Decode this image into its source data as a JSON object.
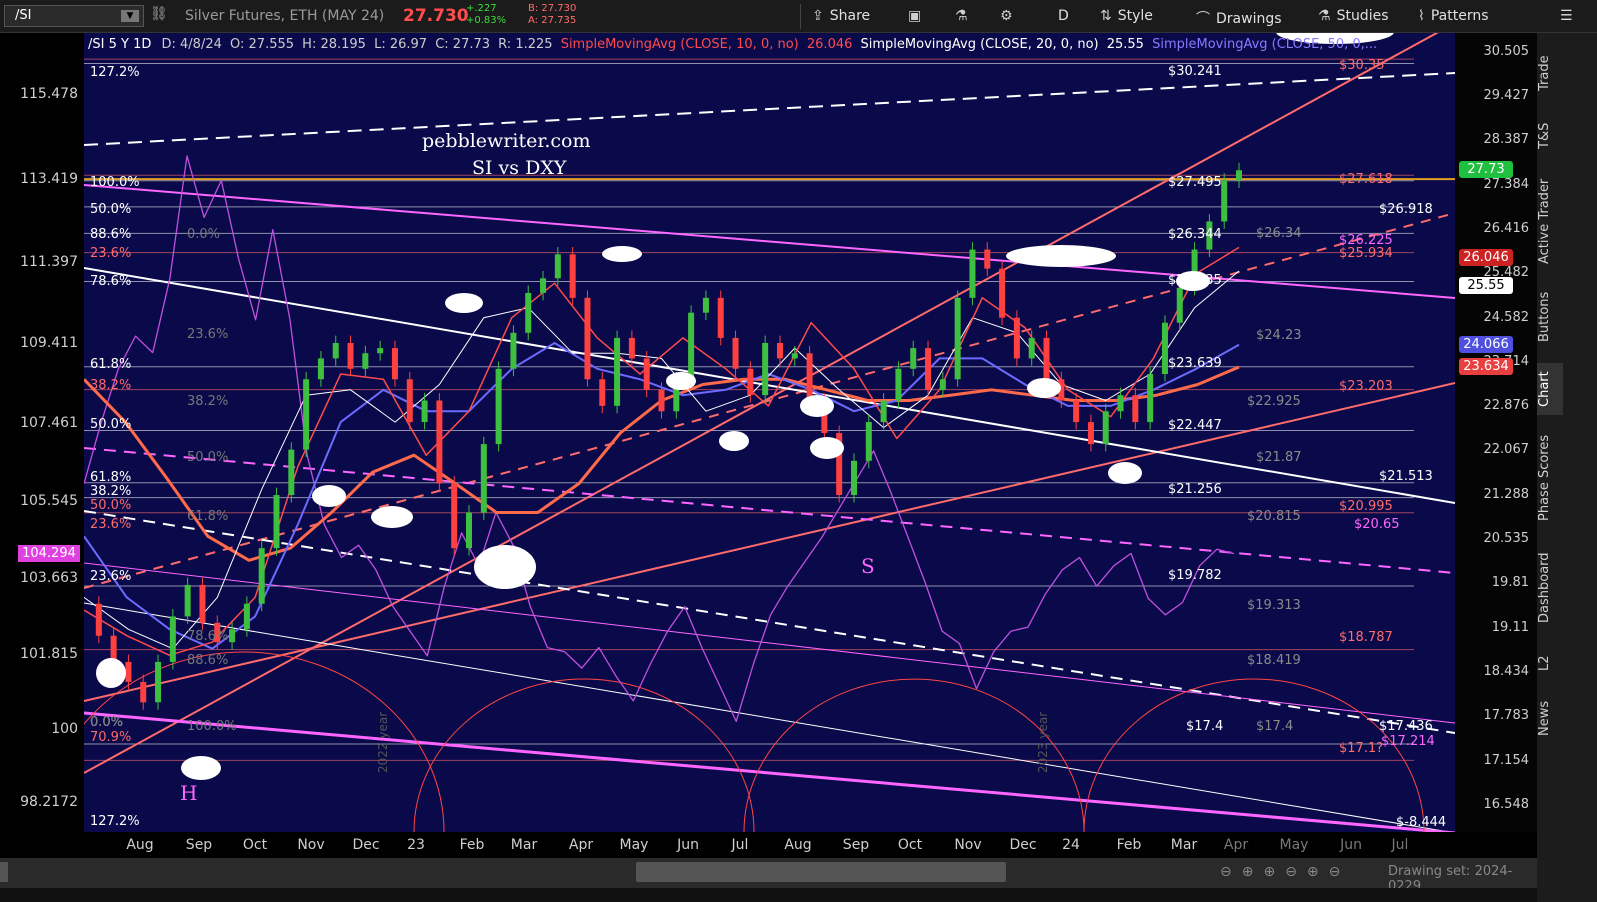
{
  "toolbar": {
    "symbol": "/SI",
    "instrument": "Silver Futures, ETH (MAY 24)",
    "last": "27.730",
    "change_abs": "+.227",
    "change_pct": "+0.83%",
    "bid": "B: 27.730",
    "ask": "A: 27.735",
    "share": "Share",
    "period": "D",
    "style": "Style",
    "drawings": "Drawings",
    "studies": "Studies",
    "patterns": "Patterns"
  },
  "studies_header": {
    "symbol_info": "/SI 5 Y 1D",
    "date": "D: 4/8/24",
    "open": "O: 27.555",
    "high": "H: 28.195",
    "low": "L: 26.97",
    "close": "C: 27.73",
    "range": "R: 1.225",
    "sma10": "SimpleMovingAvg (CLOSE, 10, 0, no)",
    "sma10_val": "26.046",
    "sma20": "SimpleMovingAvg (CLOSE, 20, 0, no)",
    "sma20_val": "25.55",
    "sma50": "SimpleMovingAvg (CLOSE, 50, 0,..."
  },
  "annotations": {
    "site": "pebblewriter.com",
    "subtitle": "SI vs DXY",
    "h_label": "H",
    "s_label": "S",
    "year_2022": "2022 year",
    "year_2023": "2023 year",
    "drawing_set": "Drawing set: 2024-0229"
  },
  "sidebar": [
    "Trade",
    "T&S",
    "Active Trader",
    "Buttons",
    "Chart",
    "Phase Scores",
    "Dashboard",
    "L2",
    "News"
  ],
  "colors": {
    "plot_bg": "#0a0a4a",
    "price_up": "#3fbf3f",
    "price_down": "#ff4040",
    "sma10": "#ff4b4b",
    "sma20": "#ffffff",
    "sma50": "#6b6bff",
    "sma_yellow": "#e8c21a",
    "sma_orange": "#ff6a4a",
    "dxy": "#c050e0",
    "fib_orange": "#ff6b6b",
    "fib_white": "#ffffff",
    "magenta": "#ff66ff"
  },
  "chart_data": {
    "type": "line",
    "title": "pebblewriter.com SI vs DXY",
    "right_axis": {
      "label": "Silver /SI",
      "ticks": [
        "30.505",
        "29.427",
        "28.387",
        "27.384",
        "26.416",
        "25.482",
        "24.582",
        "23.714",
        "22.876",
        "22.067",
        "21.288",
        "20.535",
        "19.81",
        "19.11",
        "18.434",
        "17.783",
        "17.154",
        "16.548"
      ],
      "ylim": [
        16.2,
        31.0
      ]
    },
    "left_axis": {
      "label": "DXY",
      "ticks": [
        "115.478",
        "113.419",
        "111.397",
        "109.411",
        "107.461",
        "105.545",
        "103.663",
        "101.815",
        "100",
        "98.2172"
      ],
      "highlight": "104.294",
      "ylim": [
        97.5,
        117.0
      ]
    },
    "x_axis": {
      "ticks": [
        "Aug",
        "Sep",
        "Oct",
        "Nov",
        "Dec",
        "23",
        "Feb",
        "Mar",
        "Apr",
        "May",
        "Jun",
        "Jul",
        "Aug",
        "Sep",
        "Oct",
        "Nov",
        "Dec",
        "24",
        "Feb",
        "Mar",
        "Apr",
        "May",
        "Jun",
        "Jul"
      ]
    },
    "price_tags": [
      {
        "value": "27.73",
        "color": "#1fbf3f"
      },
      {
        "value": "26.046",
        "color": "#cc2222"
      },
      {
        "value": "25.55",
        "color": "#ffffff"
      },
      {
        "value": "24.066",
        "color": "#5050e0"
      },
      {
        "value": "23.634",
        "color": "#e84040"
      }
    ],
    "level_labels_white": [
      "$30.241",
      "$27.495",
      "$26.918",
      "$26.344",
      "$25.335",
      "$23.639",
      "$22.447",
      "$21.513",
      "$21.256",
      "$19.782",
      "$17.4",
      "$17.436",
      "$-8.444"
    ],
    "level_labels_orange": [
      "$30.35",
      "$27.618",
      "$25.934",
      "$23.203",
      "$20.995",
      "$18.787",
      "$17.1?"
    ],
    "level_labels_magenta": [
      "$26.225",
      "$20.65",
      "$17.214"
    ],
    "level_labels_gray": [
      "$26.34",
      "$24.23",
      "$22.925",
      "$21.87",
      "$20.815",
      "$19.313",
      "$18.419",
      "$17.4"
    ],
    "fib_labels_left": [
      "127.2%",
      "100.0%",
      "50.0%",
      "88.6%",
      "23.6%",
      "78.6%",
      "61.8%",
      "38.2%",
      "50.0%",
      "61.8%",
      "38.2%",
      "50.0%",
      "23.6%",
      "23.6%",
      "0.0%",
      "70.9%",
      "127.2%"
    ],
    "fib_labels_gray": [
      "0.0%",
      "23.6%",
      "38.2%",
      "50.0%",
      "61.8%",
      "78.6%",
      "88.6%",
      "100.0%",
      "0.0%"
    ],
    "series": [
      {
        "name": "/SI",
        "values": [
          19.5,
          19.0,
          18.6,
          18.3,
          18.0,
          18.6,
          19.3,
          19.8,
          19.2,
          18.9,
          19.1,
          19.5,
          20.4,
          21.3,
          22.1,
          23.4,
          23.8,
          24.1,
          23.6,
          23.9,
          24.0,
          23.4,
          22.6,
          23.0,
          21.5,
          20.4,
          21.0,
          22.2,
          23.6,
          24.3,
          25.1,
          25.4,
          25.9,
          25.0,
          23.4,
          22.9,
          24.2,
          23.8,
          23.2,
          22.8,
          23.4,
          24.7,
          25.0,
          24.2,
          23.6,
          23.1,
          24.1,
          23.8,
          23.9,
          23.0,
          22.4,
          21.3,
          21.9,
          22.6,
          23.0,
          23.6,
          24.0,
          23.2,
          23.4,
          25.0,
          26.0,
          25.6,
          24.6,
          23.8,
          24.2,
          23.4,
          23.0,
          22.6,
          22.2,
          22.8,
          23.1,
          22.6,
          23.5,
          24.5,
          25.2,
          26.0,
          26.6,
          27.5,
          27.73
        ]
      },
      {
        "name": "DXY",
        "values": [
          106.0,
          107.5,
          108.8,
          109.6,
          109.2,
          111.0,
          114.0,
          112.5,
          113.4,
          111.5,
          110.0,
          112.2,
          110.0,
          106.7,
          105.0,
          104.2,
          104.5,
          103.9,
          103.0,
          102.4,
          101.8,
          103.5,
          104.8,
          104.0,
          105.3,
          104.5,
          103.0,
          102.0,
          101.9,
          101.5,
          102.0,
          101.3,
          100.7,
          101.6,
          102.4,
          103.0,
          102.0,
          101.1,
          100.2,
          101.6,
          102.8,
          103.5,
          104.1,
          104.7,
          105.4,
          106.1,
          106.8,
          105.8,
          104.7,
          103.6,
          102.4,
          102.1,
          101.0,
          101.9,
          102.4,
          102.5,
          103.3,
          103.9,
          104.2,
          103.5,
          104.0,
          104.3,
          103.2,
          102.8,
          103.1,
          104.0,
          104.4,
          104.294
        ]
      },
      {
        "name": "SMA 10",
        "values": [
          19.4,
          19.0,
          18.7,
          18.9,
          19.6,
          21.8,
          23.5,
          23.4,
          22.0,
          22.8,
          24.6,
          25.3,
          24.2,
          23.5,
          24.2,
          23.6,
          22.9,
          24.5,
          23.6,
          22.3,
          23.2,
          25.0,
          24.4,
          23.2,
          22.7,
          23.8,
          25.5,
          26.046
        ]
      },
      {
        "name": "SMA 20",
        "values": [
          19.6,
          19.1,
          18.8,
          19.6,
          21.4,
          23.1,
          23.2,
          22.6,
          23.3,
          24.6,
          24.8,
          23.9,
          23.9,
          23.8,
          22.8,
          23.1,
          24.0,
          23.2,
          22.5,
          23.1,
          24.6,
          24.3,
          23.3,
          23.0,
          23.5,
          24.8,
          25.55
        ]
      },
      {
        "name": "SMA 50",
        "values": [
          20.6,
          19.6,
          19.1,
          18.8,
          19.3,
          20.8,
          22.6,
          23.2,
          22.8,
          22.8,
          23.6,
          24.1,
          23.6,
          23.4,
          23.1,
          23.2,
          23.5,
          23.2,
          22.8,
          23.0,
          23.8,
          23.8,
          23.3,
          22.9,
          22.9,
          23.2,
          23.6,
          24.066
        ]
      },
      {
        "name": "SMA orange",
        "values": [
          23.4,
          22.6,
          21.6,
          20.6,
          20.2,
          20.4,
          21.0,
          21.7,
          22.0,
          21.5,
          21.0,
          21.0,
          21.5,
          22.4,
          23.0,
          23.3,
          23.4,
          23.4,
          23.2,
          23.0,
          23.0,
          23.1,
          23.2,
          23.1,
          23.0,
          23.0,
          23.1,
          23.3,
          23.634
        ]
      }
    ]
  }
}
